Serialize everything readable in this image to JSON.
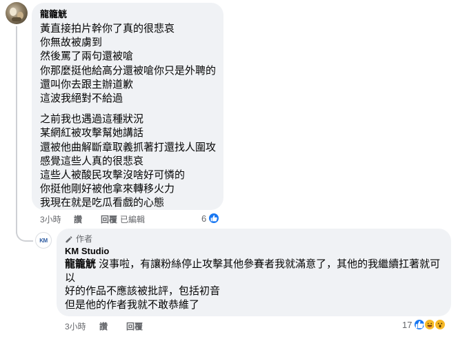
{
  "comment1": {
    "author": "龍籠觥",
    "paragraphs": [
      [
        "黃直接拍片幹你了真的很悲哀",
        "你無故被虜到",
        "然後罵了兩句還被嗆",
        "你那麼挺他給高分還被嗆你只是外聘的",
        "還叫你去跟主辦道歉",
        "這波我絕對不給過"
      ],
      [
        "之前我也遇過這種狀況",
        "某網紅被攻擊幫她講話",
        "還被他曲解斷章取義抓著打還找人圍攻",
        "感覺這些人真的很悲哀",
        "這些人被酸民攻擊沒啥好可憐的",
        "你挺他剛好被他拿來轉移火力",
        "我現在就是吃瓜看戲的心態"
      ]
    ],
    "actions": {
      "time": "3小時",
      "like": "讚",
      "reply": "回覆",
      "edited": "已編輯"
    },
    "reaction_count": "6"
  },
  "comment2": {
    "badge": "作者",
    "author": "KM Studio",
    "avatar_text": "KM",
    "mention": "龍籠觥",
    "lines": [
      " 沒事啦，有讓粉絲停止攻擊其他參賽者我就滿意了，其他的我繼續扛著就可",
      "以",
      "好的作品不應該被批評，包括初音",
      "但是他的作者我就不敢恭維了"
    ],
    "actions": {
      "time": "3小時",
      "like": "讚",
      "reply": "回覆"
    },
    "reaction_count": "17"
  },
  "colors": {
    "bubble": "#f0f2f5",
    "like_blue": "#1877f2",
    "meta_gray": "#65676b",
    "haha_yellow": "#f7b928"
  },
  "icons": [
    "like-icon",
    "pencil-icon",
    "haha-icon",
    "wow-icon"
  ]
}
